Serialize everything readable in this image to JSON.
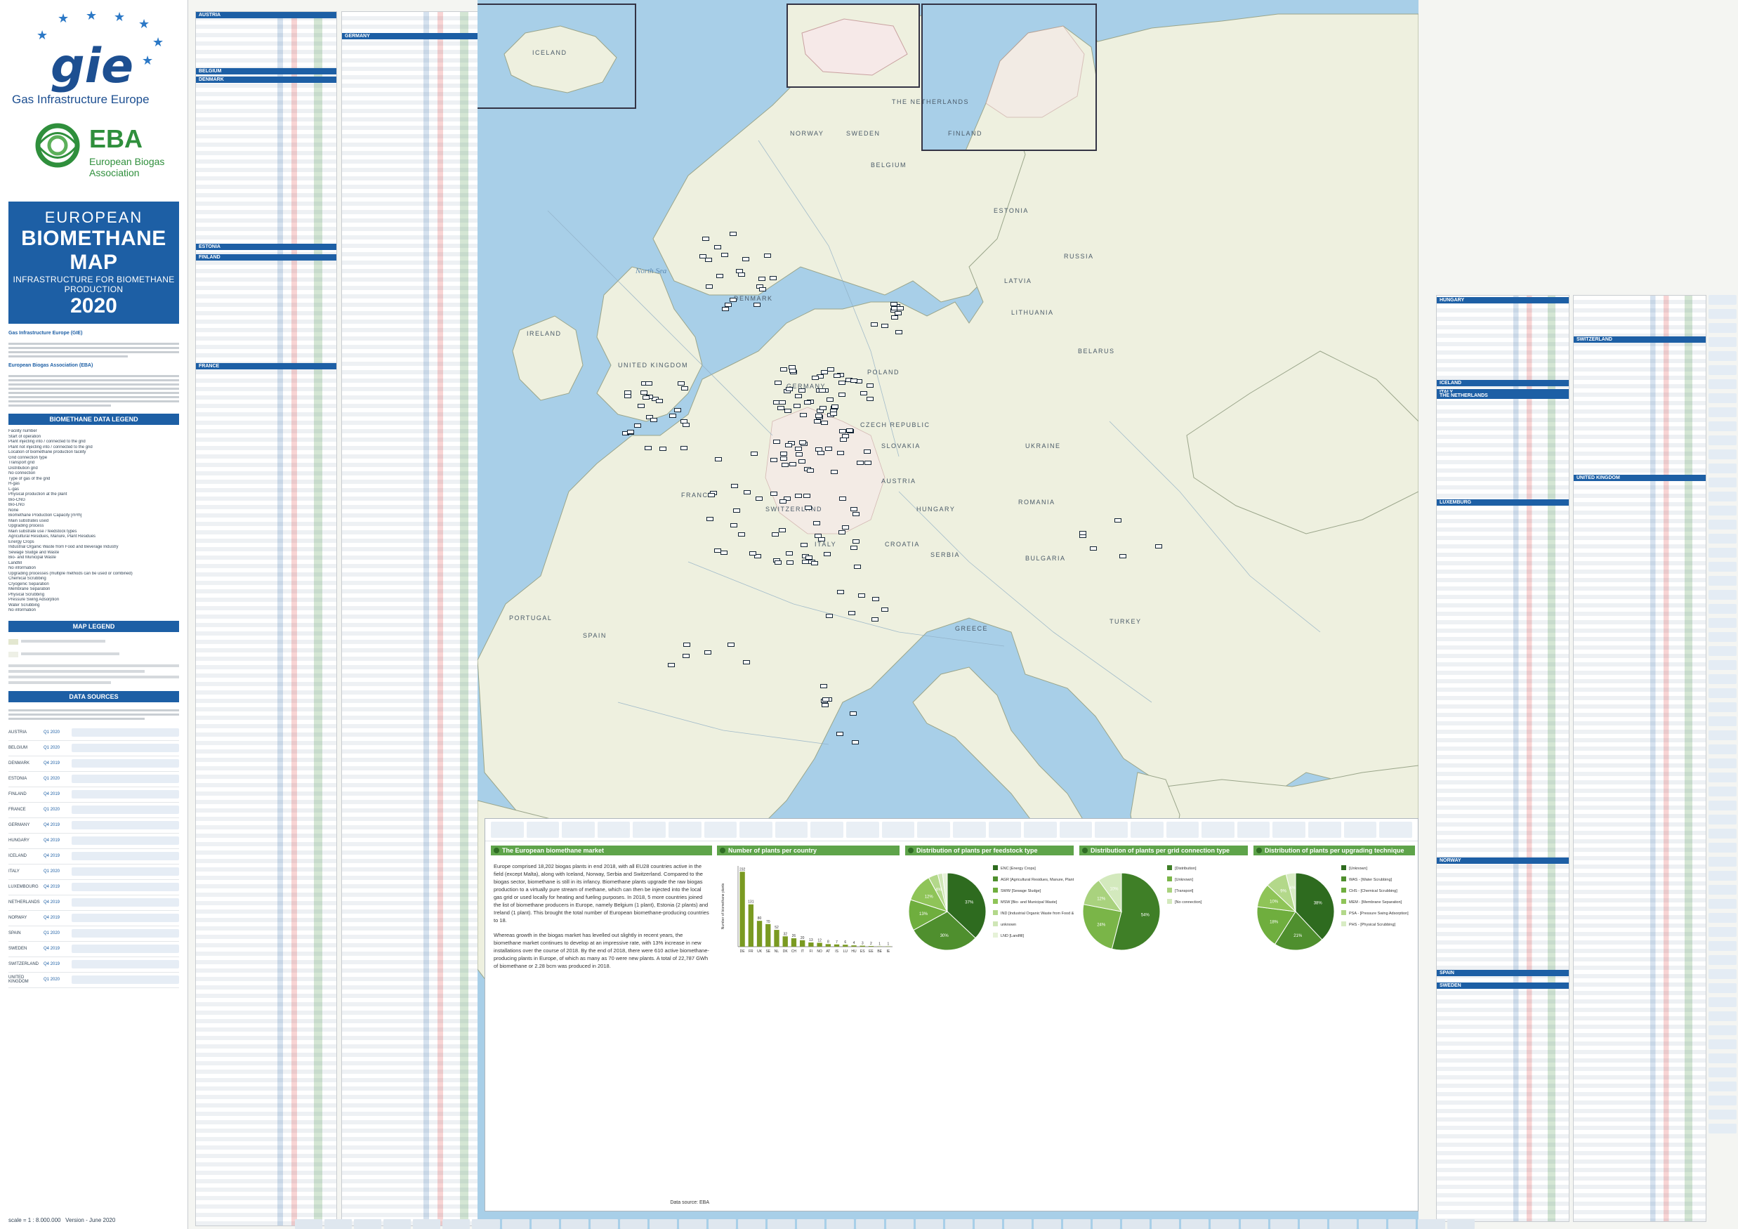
{
  "left_panel": {
    "gie_tagline": "Gas Infrastructure Europe",
    "eba_name": "EBA",
    "eba_full": "European Biogas Association",
    "title": {
      "line1": "EUROPEAN",
      "line2": "BIOMETHANE MAP",
      "line3": "INFRASTRUCTURE FOR BIOMETHANE PRODUCTION",
      "year": "2020"
    },
    "gie_org": "Gas Infrastructure Europe (GIE)",
    "eba_org": "European Biogas Association (EBA)",
    "legend_title": "BIOMETHANE DATA LEGEND",
    "legend_items": [
      {
        "label": "Facility number"
      },
      {
        "label": "Start of operation"
      },
      {
        "label": "Plant injecting into / connected to the grid"
      },
      {
        "label": "Plant not injecting into / connected to the grid"
      },
      {
        "label": "Location of biomethane production facility"
      },
      {
        "label": "Grid connection type"
      },
      {
        "label": "Transport grid"
      },
      {
        "label": "Distribution grid"
      },
      {
        "label": "No connection"
      },
      {
        "label": "Type of gas of the grid"
      },
      {
        "label": "H-gas"
      },
      {
        "label": "L-gas"
      },
      {
        "label": "Physical production at the plant"
      },
      {
        "label": "Bio-CNG"
      },
      {
        "label": "Bio-LNG"
      },
      {
        "label": "None"
      },
      {
        "label": "Biomethane Production Capacity [m³/h]"
      },
      {
        "label": "Main substrates used"
      },
      {
        "label": "Upgrading process"
      },
      {
        "label": "Main substrate use / feedstock types"
      },
      {
        "label": "Agricultural Residues, Manure, Plant Residues"
      },
      {
        "label": "Energy Crops"
      },
      {
        "label": "Industrial Organic Waste from Food and Beverage Industry"
      },
      {
        "label": "Sewage Sludge and Waste"
      },
      {
        "label": "Bio- and Municipal Waste"
      },
      {
        "label": "Landfill"
      },
      {
        "label": "No information"
      },
      {
        "label": "Upgrading processes (multiple methods can be used or combined)"
      },
      {
        "label": "Chemical Scrubbing"
      },
      {
        "label": "Cryogenic Separation"
      },
      {
        "label": "Membrane Separation"
      },
      {
        "label": "Physical Scrubbing"
      },
      {
        "label": "Pressure Swing Adsorption"
      },
      {
        "label": "Water Scrubbing"
      },
      {
        "label": "No information"
      }
    ],
    "map_legend_title": "MAP LEGEND",
    "data_sources_title": "DATA SOURCES",
    "sources": [
      {
        "country": "AUSTRIA",
        "date": "Q1 2020"
      },
      {
        "country": "BELGIUM",
        "date": "Q1 2020"
      },
      {
        "country": "DENMARK",
        "date": "Q4 2019"
      },
      {
        "country": "ESTONIA",
        "date": "Q1 2020"
      },
      {
        "country": "FINLAND",
        "date": "Q4 2019"
      },
      {
        "country": "FRANCE",
        "date": "Q1 2020"
      },
      {
        "country": "GERMANY",
        "date": "Q4 2019"
      },
      {
        "country": "HUNGARY",
        "date": "Q4 2019"
      },
      {
        "country": "ICELAND",
        "date": "Q4 2019"
      },
      {
        "country": "ITALY",
        "date": "Q1 2020"
      },
      {
        "country": "LUXEMBOURG",
        "date": "Q4 2019"
      },
      {
        "country": "NETHERLANDS",
        "date": "Q4 2019"
      },
      {
        "country": "NORWAY",
        "date": "Q4 2019"
      },
      {
        "country": "SPAIN",
        "date": "Q1 2020"
      },
      {
        "country": "SWEDEN",
        "date": "Q4 2019"
      },
      {
        "country": "SWITZERLAND",
        "date": "Q4 2019"
      },
      {
        "country": "UNITED KINGDOM",
        "date": "Q1 2020"
      }
    ],
    "scale": "scale = 1 : 8.000.000",
    "version": "Version - June 2020"
  },
  "country_headers": {
    "col1": [
      "AUSTRIA",
      "BELGIUM",
      "DENMARK",
      "ESTONIA",
      "FINLAND",
      "FRANCE"
    ],
    "col2": [
      "GERMANY"
    ],
    "right1": [
      "HUNGARY",
      "ICELAND",
      "ITALY",
      "LUXEMBURG",
      "THE NETHERLANDS",
      "NORWAY",
      "SPAIN",
      "SWEDEN"
    ],
    "right2": [
      "SWITZERLAND",
      "UNITED KINGDOM"
    ]
  },
  "map": {
    "countries": [
      "ICELAND",
      "NORWAY",
      "SWEDEN",
      "FINLAND",
      "ESTONIA",
      "LATVIA",
      "LITHUANIA",
      "RUSSIA",
      "BELARUS",
      "IRELAND",
      "UNITED KINGDOM",
      "DENMARK",
      "GERMANY",
      "POLAND",
      "CZECH REPUBLIC",
      "SLOVAKIA",
      "UKRAINE",
      "AUSTRIA",
      "HUNGARY",
      "ROMANIA",
      "FRANCE",
      "SWITZERLAND",
      "ITALY",
      "CROATIA",
      "SERBIA",
      "BULGARIA",
      "GREECE",
      "TURKEY",
      "SPAIN",
      "PORTUGAL",
      "BELGIUM",
      "THE NETHERLANDS"
    ],
    "seas": [
      "North Sea"
    ]
  },
  "bottom": {
    "market_title": "The European biomethane market",
    "market_p1": "Europe comprised 18,202 biogas plants in end 2018, with all EU28 countries active in the field (except Malta), along with Iceland, Norway, Serbia and Switzerland. Compared to the biogas sector, biomethane is still in its infancy. Biomethane plants upgrade the raw biogas production to a virtually pure stream of methane, which can then be injected into the local gas grid or used locally for heating and fueling purposes. In 2018, 5 more countries joined the list of biomethane producers in Europe, namely Belgium (1 plant), Estonia (2 plants) and Ireland (1 plant). This brought the total number of European biomethane-producing countries to 18.",
    "market_p2": "Whereas growth in the biogas market has levelled out slightly in recent years, the biomethane market continues to develop at an impressive rate, with 13% increase in new installations over the course of 2018. By the end of 2018, there were 610 active biomethane-producing plants in Europe, of which as many as 70 were new plants. A total of 22,787 GWh of biomethane or 2.28 bcm was produced in 2018.",
    "data_source": "Data source: EBA"
  },
  "chart_data": [
    {
      "type": "bar",
      "title": "Number of plants per country",
      "ylabel": "Number of biomethane plants",
      "categories": [
        "DE",
        "FR",
        "UK",
        "SE",
        "NL",
        "DK",
        "CH",
        "IT",
        "FI",
        "NO",
        "AT",
        "IS",
        "LU",
        "HU",
        "ES",
        "EE",
        "BE",
        "IE"
      ],
      "values": [
        232,
        131,
        80,
        70,
        52,
        32,
        26,
        20,
        13,
        12,
        8,
        7,
        6,
        4,
        3,
        2,
        1,
        1
      ],
      "ylim": [
        0,
        250
      ],
      "color": "#7a9a22"
    },
    {
      "type": "pie",
      "title": "Distribution of plants per feedstock type",
      "labels": [
        "ENC [Energy Crops]",
        "AGR [Agricultural Residues, Manure, Plant Residues]",
        "SWW [Sewage Sludge]",
        "MSW [Bio- and Municipal Waste]",
        "IND [Industrial Organic Waste from Food & Beverage Industries]",
        "unknown",
        "LND [Landfill]"
      ],
      "values": [
        37,
        30,
        13,
        12,
        4,
        2,
        2
      ],
      "colors": [
        "#2e6b1f",
        "#4f8f2e",
        "#6fae3e",
        "#8fc458",
        "#b3d88a",
        "#cfe6b6",
        "#e6f2d8"
      ]
    },
    {
      "type": "pie",
      "title": "Distribution of plants per grid connection type",
      "labels": [
        "[Distribution]",
        "[Unknown]",
        "[Transport]",
        "[No connection]"
      ],
      "values": [
        54,
        24,
        12,
        10
      ],
      "colors": [
        "#3f7f27",
        "#7ab548",
        "#a9d27e",
        "#d3e9bd"
      ]
    },
    {
      "type": "pie",
      "title": "Distribution of plants per upgrading technique",
      "labels": [
        "[Unknown]",
        "WAS - [Water Scrubbing]",
        "CHS - [Chemical Scrubbing]",
        "MEM - [Membrane Separation]",
        "PSA - [Pressure Swing Adsorption]",
        "PHS - [Physical Scrubbing]"
      ],
      "values": [
        38,
        21,
        18,
        10,
        9,
        4
      ],
      "colors": [
        "#2e6b1f",
        "#4f8f2e",
        "#6fae3e",
        "#8fc458",
        "#b3d88a",
        "#d8ecc4"
      ]
    }
  ]
}
